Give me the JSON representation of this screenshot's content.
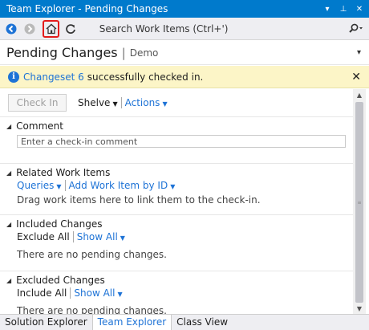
{
  "window": {
    "title": "Team Explorer - Pending Changes",
    "dropdown_glyph": "▾",
    "pin_glyph": "⊥",
    "close_glyph": "✕"
  },
  "toolbar": {
    "search_placeholder": "Search Work Items (Ctrl+')"
  },
  "header": {
    "title": "Pending Changes",
    "separator": "|",
    "subtitle": "Demo"
  },
  "banner": {
    "link": "Changeset 6",
    "message": "successfully checked in."
  },
  "actions": {
    "checkin": "Check In",
    "shelve": "Shelve",
    "actions": "Actions"
  },
  "sections": {
    "comment": {
      "title": "Comment",
      "placeholder": "Enter a check-in comment"
    },
    "related": {
      "title": "Related Work Items",
      "queries": "Queries",
      "add": "Add Work Item by ID",
      "hint": "Drag work items here to link them to the check-in."
    },
    "included": {
      "title": "Included Changes",
      "exclude_all": "Exclude All",
      "show_all": "Show All",
      "empty": "There are no pending changes."
    },
    "excluded": {
      "title": "Excluded Changes",
      "include_all": "Include All",
      "show_all": "Show All",
      "empty": "There are no pending changes."
    }
  },
  "tabs": [
    {
      "label": "Solution Explorer"
    },
    {
      "label": "Team Explorer"
    },
    {
      "label": "Class View"
    }
  ],
  "colors": {
    "accent": "#007acc",
    "link": "#1e73d6",
    "banner": "#fcf5c7",
    "highlight": "#e31b1b"
  }
}
